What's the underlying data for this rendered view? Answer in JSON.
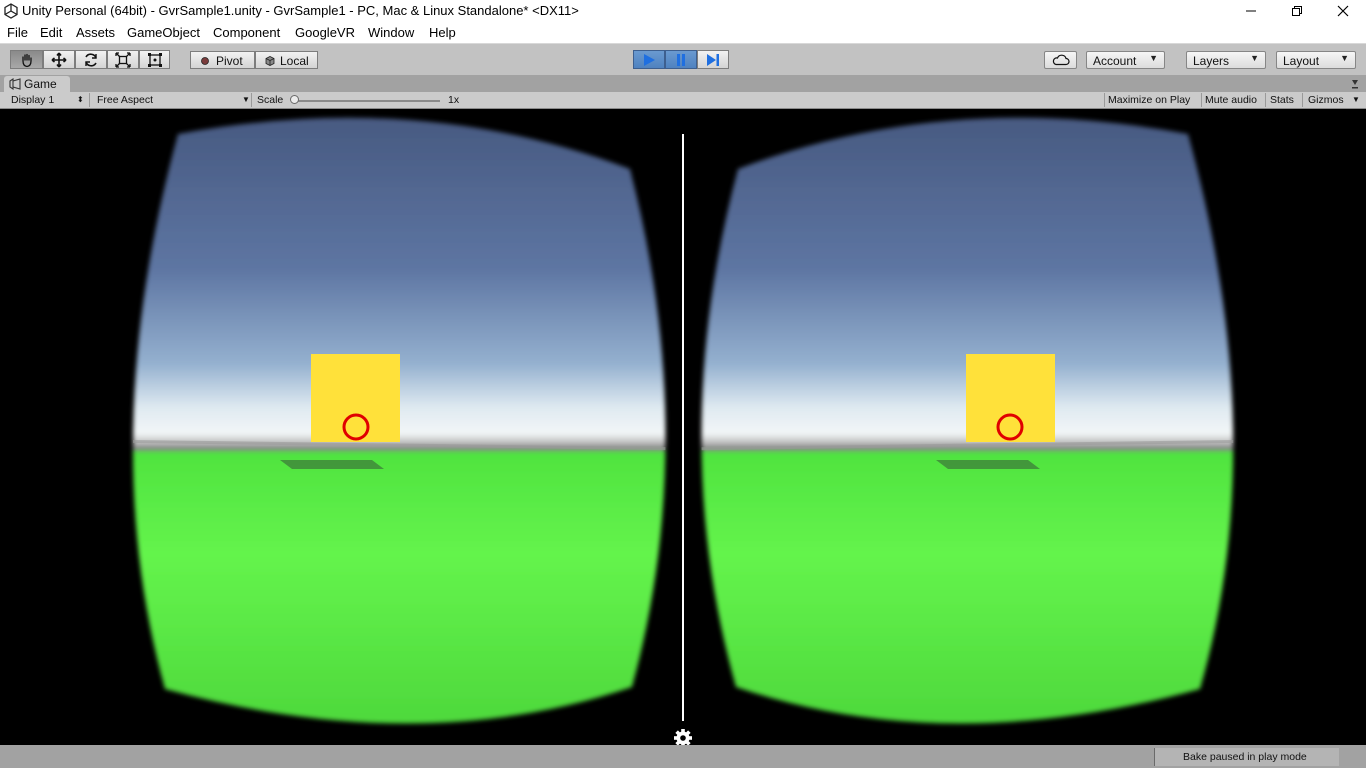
{
  "window": {
    "title": "Unity Personal (64bit) - GvrSample1.unity - GvrSample1 - PC, Mac & Linux Standalone* <DX11>"
  },
  "menu": [
    "File",
    "Edit",
    "Assets",
    "GameObject",
    "Component",
    "GoogleVR",
    "Window",
    "Help"
  ],
  "toolbar": {
    "pivot_label": "Pivot",
    "local_label": "Local",
    "account_label": "Account",
    "layers_label": "Layers",
    "layout_label": "Layout"
  },
  "game_view": {
    "tab_label": "Game",
    "display_label": "Display 1",
    "aspect_label": "Free Aspect",
    "scale_label": "Scale",
    "scale_value": "1x",
    "maximize_label": "Maximize on Play",
    "mute_label": "Mute audio",
    "stats_label": "Stats",
    "gizmos_label": "Gizmos"
  },
  "status": {
    "bake_text": "Bake paused in play mode"
  },
  "colors": {
    "play_active": "#4a8bd6",
    "sky_top": "#4c5f8c",
    "ground": "#5ef048",
    "cube": "#ffe13a",
    "reticle": "#e00000"
  }
}
